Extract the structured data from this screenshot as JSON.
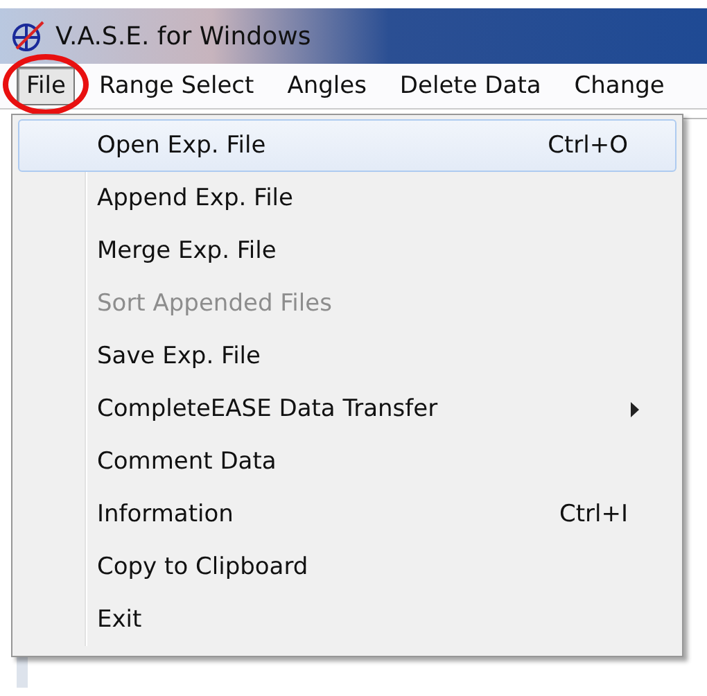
{
  "window": {
    "title": "V.A.S.E. for Windows"
  },
  "menu_bar": [
    {
      "label": "File",
      "selected": true,
      "circled": true
    },
    {
      "label": "Range Select",
      "selected": false,
      "circled": false
    },
    {
      "label": "Angles",
      "selected": false,
      "circled": false
    },
    {
      "label": "Delete Data",
      "selected": false,
      "circled": false
    },
    {
      "label": "Change",
      "selected": false,
      "circled": false
    }
  ],
  "file_menu": [
    {
      "label": "Open Exp. File",
      "shortcut": "Ctrl+O",
      "selected": true,
      "disabled": false,
      "submenu": false
    },
    {
      "label": "Append Exp. File",
      "selected": false,
      "disabled": false,
      "submenu": false
    },
    {
      "label": "Merge Exp. File",
      "selected": false,
      "disabled": false,
      "submenu": false
    },
    {
      "label": "Sort Appended Files",
      "selected": false,
      "disabled": true,
      "submenu": false
    },
    {
      "label": "Save Exp. File",
      "selected": false,
      "disabled": false,
      "submenu": false
    },
    {
      "label": "CompleteEASE Data Transfer",
      "selected": false,
      "disabled": false,
      "submenu": true
    },
    {
      "label": "Comment Data",
      "selected": false,
      "disabled": false,
      "submenu": false
    },
    {
      "label": "Information",
      "shortcut": "Ctrl+I",
      "selected": false,
      "disabled": false,
      "submenu": false
    },
    {
      "label": "Copy to Clipboard",
      "selected": false,
      "disabled": false,
      "submenu": false
    },
    {
      "label": "Exit",
      "selected": false,
      "disabled": false,
      "submenu": false
    }
  ]
}
